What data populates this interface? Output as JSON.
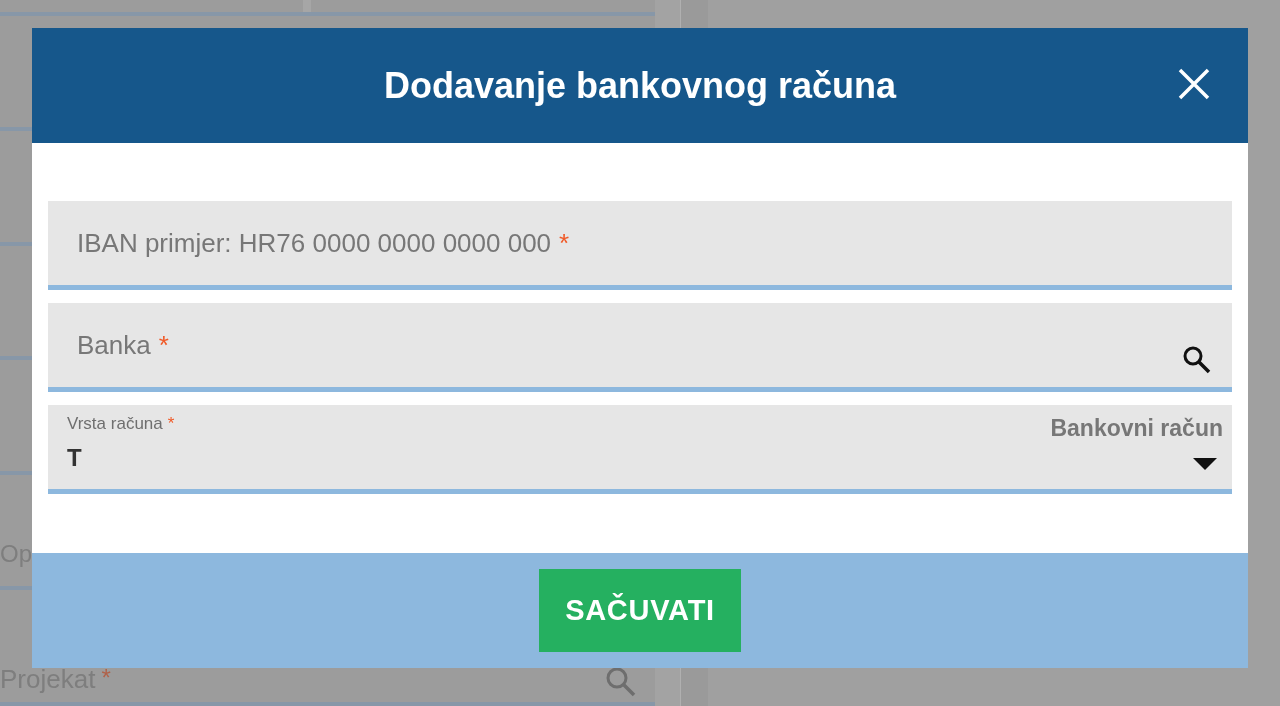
{
  "background_form": {
    "fields": [
      {
        "label": "Op"
      },
      {
        "label": "Projekat",
        "required_mark": "*"
      }
    ]
  },
  "dialog": {
    "title": "Dodavanje bankovnog računa",
    "fields": [
      {
        "kind": "text",
        "placeholder": "IBAN primjer: HR76 0000 0000 0000 000",
        "required_mark": "*"
      },
      {
        "kind": "search",
        "placeholder": "Banka",
        "required_mark": "*"
      },
      {
        "kind": "select",
        "label": "Vrsta računa",
        "required_mark": "*",
        "value": "T",
        "hint": "Bankovni račun"
      }
    ],
    "save_button": "SAČUVATI"
  }
}
